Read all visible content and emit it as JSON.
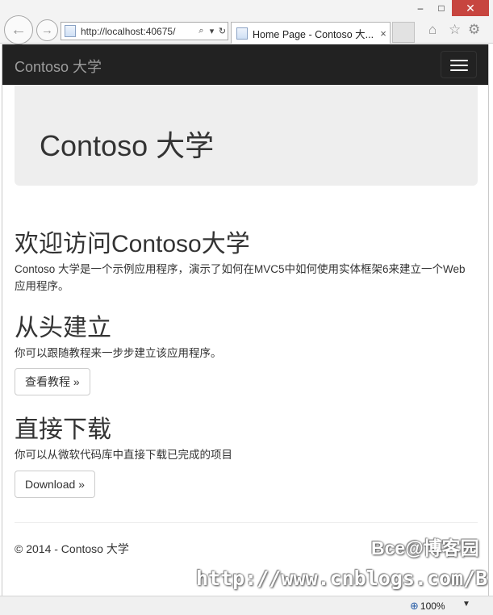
{
  "browser": {
    "address": "http://localhost:40675/",
    "tab_title": "Home Page - Contoso 大...",
    "tab_close": "×",
    "window_buttons": {
      "minimize": "–",
      "maximize": "□",
      "close": "✕"
    },
    "icons": {
      "back": "back-arrow-icon",
      "forward": "forward-arrow-icon",
      "home": "home-icon",
      "favorites": "star-icon",
      "tools": "gear-icon"
    },
    "zoom": "100%"
  },
  "navbar": {
    "brand": "Contoso 大学"
  },
  "jumbotron": {
    "title": "Contoso 大学"
  },
  "sections": [
    {
      "title": "欢迎访问Contoso大学",
      "text": "Contoso 大学是一个示例应用程序，演示了如何在MVC5中如何使用实体框架6来建立一个Web应用程序。"
    },
    {
      "title": "从头建立",
      "text": "你可以跟随教程来一步步建立该应用程序。",
      "button": "查看教程 »"
    },
    {
      "title": "直接下载",
      "text": "你可以从微软代码库中直接下载已完成的项目",
      "button": "Download »"
    }
  ],
  "footer": {
    "text": "© 2014 - Contoso 大学"
  },
  "watermark": {
    "line1": "Bce@博客园",
    "line2": "http://www.cnblogs.com/Bce-/"
  }
}
